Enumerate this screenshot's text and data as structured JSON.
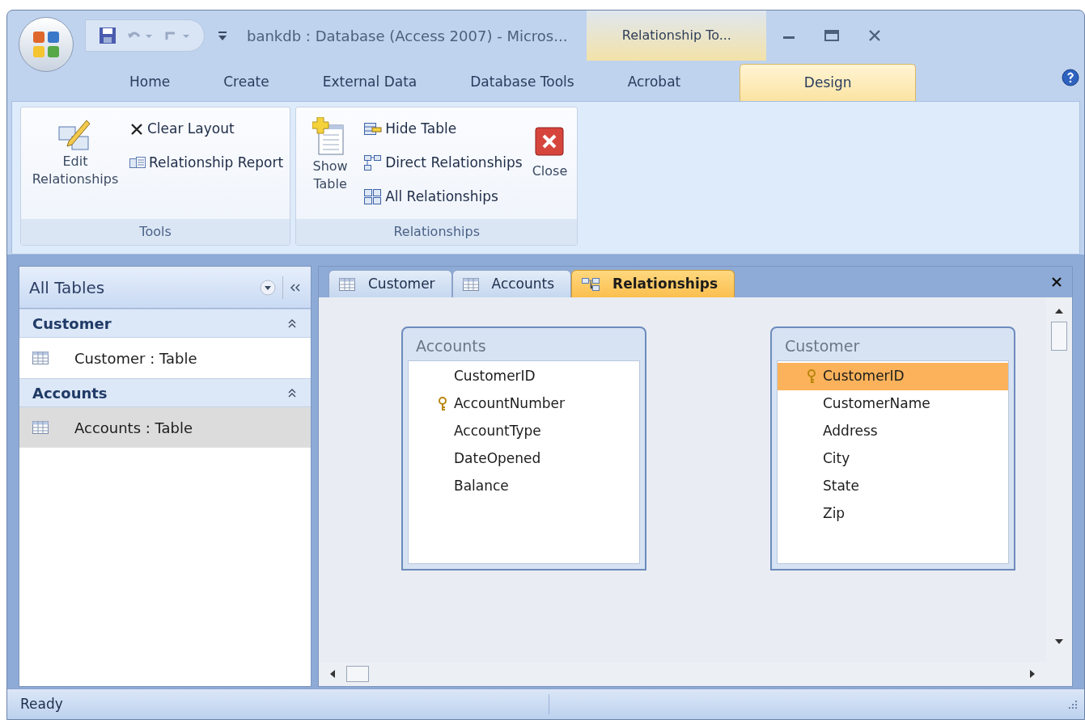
{
  "window": {
    "title": "bankdb : Database (Access 2007) - Micros...",
    "context_group": "Relationship To..."
  },
  "ribbon_tabs": [
    {
      "label": "Home",
      "selected": false
    },
    {
      "label": "Create",
      "selected": false
    },
    {
      "label": "External Data",
      "selected": false
    },
    {
      "label": "Database Tools",
      "selected": false
    },
    {
      "label": "Acrobat",
      "selected": false
    },
    {
      "label": "Design",
      "selected": true
    }
  ],
  "ribbon_groups": [
    {
      "title": "Tools",
      "buttons": [
        {
          "label": "Edit Relationships",
          "kind": "edit"
        },
        {
          "label": "Clear Layout",
          "kind": "clear"
        },
        {
          "label": "Relationship Report",
          "kind": "report"
        }
      ]
    },
    {
      "title": "Relationships",
      "buttons": [
        {
          "label": "Show Table",
          "kind": "show"
        },
        {
          "label": "Hide Table",
          "kind": "hide"
        },
        {
          "label": "Direct Relationships",
          "kind": "direct"
        },
        {
          "label": "All Relationships",
          "kind": "all"
        },
        {
          "label": "Close",
          "kind": "close"
        }
      ]
    }
  ],
  "nav_pane": {
    "title": "All Tables",
    "groups": [
      {
        "title": "Customer",
        "items": [
          {
            "label": "Customer : Table",
            "selected": false
          }
        ]
      },
      {
        "title": "Accounts",
        "items": [
          {
            "label": "Accounts : Table",
            "selected": true
          }
        ]
      }
    ]
  },
  "document_tabs": [
    {
      "label": "Customer",
      "kind": "table",
      "selected": false
    },
    {
      "label": "Accounts",
      "kind": "table",
      "selected": false
    },
    {
      "label": "Relationships",
      "kind": "relationships",
      "selected": true
    }
  ],
  "tables": [
    {
      "title": "Accounts",
      "fields": [
        {
          "name": "CustomerID",
          "primary_key": false,
          "selected": false
        },
        {
          "name": "AccountNumber",
          "primary_key": true,
          "selected": false
        },
        {
          "name": "AccountType",
          "primary_key": false,
          "selected": false
        },
        {
          "name": "DateOpened",
          "primary_key": false,
          "selected": false
        },
        {
          "name": "Balance",
          "primary_key": false,
          "selected": false
        }
      ]
    },
    {
      "title": "Customer",
      "fields": [
        {
          "name": "CustomerID",
          "primary_key": true,
          "selected": true
        },
        {
          "name": "CustomerName",
          "primary_key": false,
          "selected": false
        },
        {
          "name": "Address",
          "primary_key": false,
          "selected": false
        },
        {
          "name": "City",
          "primary_key": false,
          "selected": false
        },
        {
          "name": "State",
          "primary_key": false,
          "selected": false
        },
        {
          "name": "Zip",
          "primary_key": false,
          "selected": false
        }
      ]
    }
  ],
  "status_bar": {
    "text": "Ready"
  }
}
